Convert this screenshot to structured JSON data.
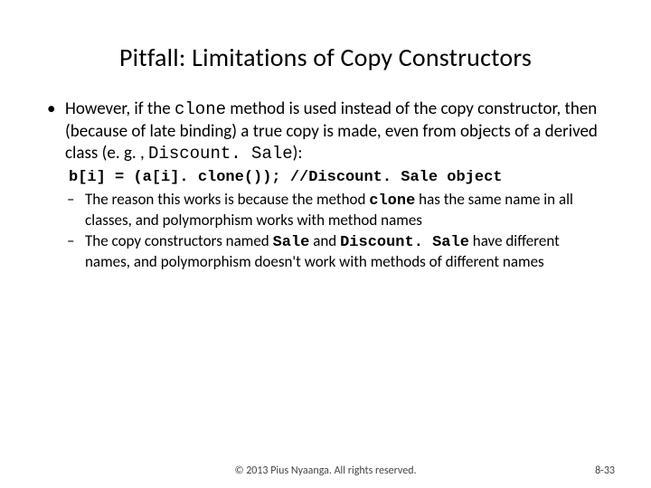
{
  "title": "Pitfall:  Limitations of Copy Constructors",
  "main": {
    "p1a": "However, if the ",
    "p1b": "clone",
    "p1c": " method is used instead of the copy constructor, then (because of late binding) a true copy is made, even from objects of a derived class (e. g. , ",
    "p1d": "Discount. Sale",
    "p1e": "):",
    "code": "b[i] = (a[i]. clone()); //Discount. Sale object",
    "r1a": "The reason this works is because the method ",
    "r1b": "clone",
    "r1c": " has the same name in all classes, and polymorphism works with method names",
    "r2a": "The copy constructors named ",
    "r2b": "Sale",
    "r2c": " and ",
    "r2d": "Discount. Sale",
    "r2e": " have different names, and polymorphism doesn't work with methods of different names"
  },
  "footer": {
    "copyright": "© 2013 Pius Nyaanga. All rights reserved.",
    "pagenum": "8-33"
  }
}
